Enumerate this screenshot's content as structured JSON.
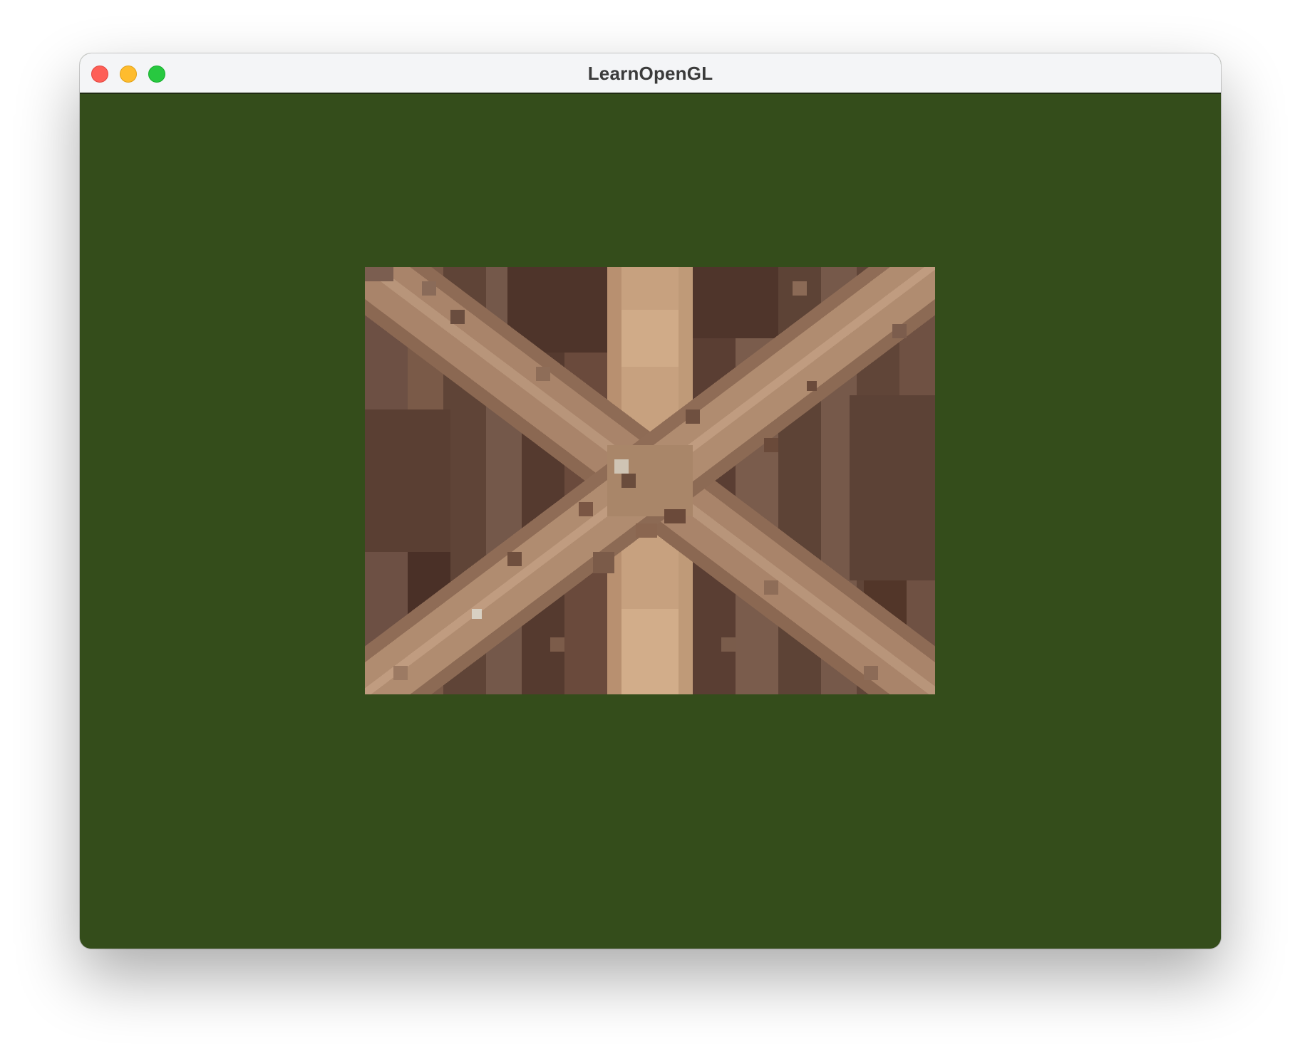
{
  "window": {
    "title": "LearnOpenGL"
  },
  "controls": {
    "close": "close-icon",
    "minimize": "minimize-icon",
    "maximize": "maximize-icon"
  },
  "colors": {
    "clear_color": "#344d1b",
    "titlebar": "#f4f5f7",
    "close": "#fe5f57",
    "minimize": "#febc2e",
    "maximize": "#28c840"
  },
  "texture": {
    "subject": "wooden-container-texture",
    "filtering": "nearest"
  }
}
